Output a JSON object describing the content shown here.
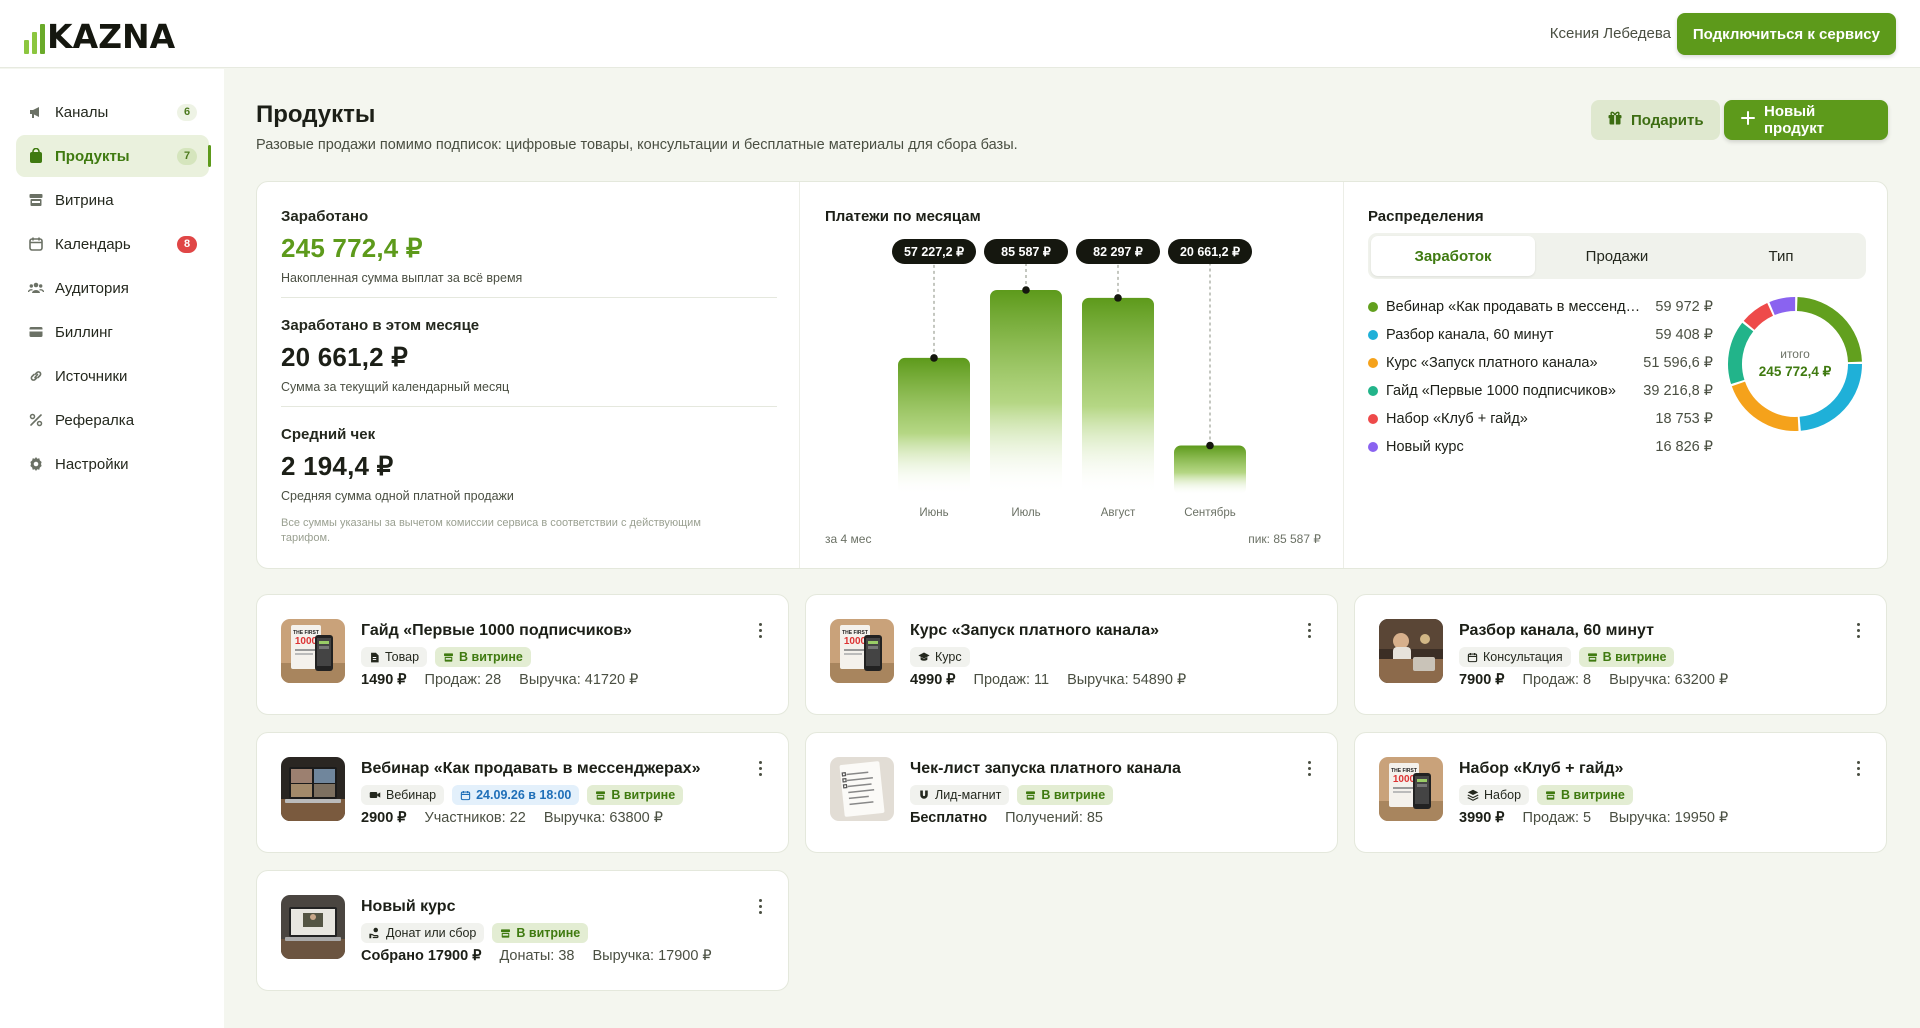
{
  "brand": {
    "logo_text": "KAZNA"
  },
  "topbar": {
    "user_name": "Ксения Лебедева",
    "connect_label": "Подключиться к сервису"
  },
  "sidebar": {
    "items": [
      {
        "label": "Каналы",
        "icon": "megaphone-icon",
        "count": "6"
      },
      {
        "label": "Продукты",
        "icon": "bag-icon",
        "count": "7",
        "active": true
      },
      {
        "label": "Витрина",
        "icon": "storefront-icon"
      },
      {
        "label": "Календарь",
        "icon": "calendar-icon",
        "count": "8",
        "alert": true
      },
      {
        "label": "Аудитория",
        "icon": "users-icon"
      },
      {
        "label": "Биллинг",
        "icon": "credit-card-icon"
      },
      {
        "label": "Источники",
        "icon": "link-icon"
      },
      {
        "label": "Рефералка",
        "icon": "percent-icon"
      },
      {
        "label": "Настройки",
        "icon": "gear-icon"
      }
    ]
  },
  "page": {
    "title": "Продукты",
    "subtitle": "Разовые продажи помимо подписок: цифровые товары, консультации и бесплатные материалы для сбора базы.",
    "gift_label": "Подарить",
    "new_product_label": "Новый продукт"
  },
  "stats": {
    "earned": {
      "title": "Заработано",
      "value": "245 772,4 ₽",
      "desc": "Накопленная сумма выплат за всё время"
    },
    "month": {
      "title": "Заработано в этом месяце",
      "value": "20 661,2 ₽",
      "desc": "Сумма за текущий календарный месяц"
    },
    "avg": {
      "title": "Средний чек",
      "value": "2 194,4 ₽",
      "desc": "Средняя сумма одной платной продажи"
    },
    "note": "Все суммы указаны за вычетом комиссии сервиса в соответствии с действующим тарифом."
  },
  "chart_data": {
    "type": "bar",
    "title": "Платежи по месяцам",
    "categories": [
      "Июнь",
      "Июль",
      "Август",
      "Сентябрь"
    ],
    "values": [
      57227.2,
      85587,
      82297,
      20661.2
    ],
    "value_labels": [
      "57 227,2 ₽",
      "85 587 ₽",
      "82 297 ₽",
      "20 661,2 ₽"
    ],
    "ylim": [
      0,
      85587
    ],
    "footer_left": "за 4 мес",
    "footer_right": "пик: 85 587 ₽",
    "color": "#5d9a1b"
  },
  "distribution": {
    "title": "Распределения",
    "tabs": [
      "Заработок",
      "Продажи",
      "Тип"
    ],
    "active_tab": 0,
    "total_label": "итого",
    "total_value": "245 772,4 ₽",
    "items": [
      {
        "name": "Вебинар «Как продавать в мессенджерах»",
        "value_text": "59 972 ₽",
        "value": 59972,
        "color": "#62a01e"
      },
      {
        "name": "Разбор канала, 60 минут",
        "value_text": "59 408 ₽",
        "value": 59408,
        "color": "#1fb0d8"
      },
      {
        "name": "Курс «Запуск платного канала»",
        "value_text": "51 596,6 ₽",
        "value": 51596.6,
        "color": "#f5a21b"
      },
      {
        "name": "Гайд «Первые 1000 подписчиков»",
        "value_text": "39 216,8 ₽",
        "value": 39216.8,
        "color": "#22b48a"
      },
      {
        "name": "Набор «Клуб + гайд»",
        "value_text": "18 753 ₽",
        "value": 18753,
        "color": "#ee4a4a"
      },
      {
        "name": "Новый курс",
        "value_text": "16 826 ₽",
        "value": 16826,
        "color": "#8a63f0"
      }
    ]
  },
  "products": [
    {
      "name": "Гайд «Первые 1000 подписчиков»",
      "thumb": "book",
      "tags": [
        {
          "text": "Товар",
          "icon": "document-icon",
          "style": "gray"
        },
        {
          "text": "В витрине",
          "icon": "storefront-icon",
          "style": "green"
        }
      ],
      "price": "1490 ₽",
      "m1": "Продаж: 28",
      "m2": "Выручка: 41720 ₽"
    },
    {
      "name": "Курс «Запуск платного канала»",
      "thumb": "book",
      "tags": [
        {
          "text": "Курс",
          "icon": "graduation-cap-icon",
          "style": "gray"
        }
      ],
      "price": "4990 ₽",
      "m1": "Продаж: 11",
      "m2": "Выручка: 54890 ₽"
    },
    {
      "name": "Разбор канала, 60 минут",
      "thumb": "desk",
      "tags": [
        {
          "text": "Консультация",
          "icon": "calendar-icon",
          "style": "gray"
        },
        {
          "text": "В витрине",
          "icon": "storefront-icon",
          "style": "green"
        }
      ],
      "price": "7900 ₽",
      "m1": "Продаж: 8",
      "m2": "Выручка: 63200 ₽"
    },
    {
      "name": "Вебинар «Как продавать в мессенджерах»",
      "thumb": "laptop",
      "tags": [
        {
          "text": "Вебинар",
          "icon": "video-icon",
          "style": "gray"
        },
        {
          "text": "24.09.26 в 18:00",
          "icon": "calendar-icon",
          "style": "blue"
        },
        {
          "text": "В витрине",
          "icon": "storefront-icon",
          "style": "green"
        }
      ],
      "price": "2900 ₽",
      "m1": "Участников: 22",
      "m2": "Выручка: 63800 ₽"
    },
    {
      "name": "Чек-лист запуска платного канала",
      "thumb": "paper",
      "tags": [
        {
          "text": "Лид-магнит",
          "icon": "magnet-icon",
          "style": "gray"
        },
        {
          "text": "В витрине",
          "icon": "storefront-icon",
          "style": "green"
        }
      ],
      "price": "Бесплатно",
      "m1": "Получений: 85",
      "m2": ""
    },
    {
      "name": "Набор «Клуб + гайд»",
      "thumb": "book",
      "tags": [
        {
          "text": "Набор",
          "icon": "layers-icon",
          "style": "gray"
        },
        {
          "text": "В витрине",
          "icon": "storefront-icon",
          "style": "green"
        }
      ],
      "price": "3990 ₽",
      "m1": "Продаж: 5",
      "m2": "Выручка: 19950 ₽"
    },
    {
      "name": "Новый курс",
      "thumb": "laptop2",
      "tags": [
        {
          "text": "Донат или сбор",
          "icon": "hand-coin-icon",
          "style": "gray"
        },
        {
          "text": "В витрине",
          "icon": "storefront-icon",
          "style": "green"
        }
      ],
      "price": "Собрано 17900 ₽",
      "m1": "Донаты: 38",
      "m2": "Выручка: 17900 ₽"
    }
  ]
}
